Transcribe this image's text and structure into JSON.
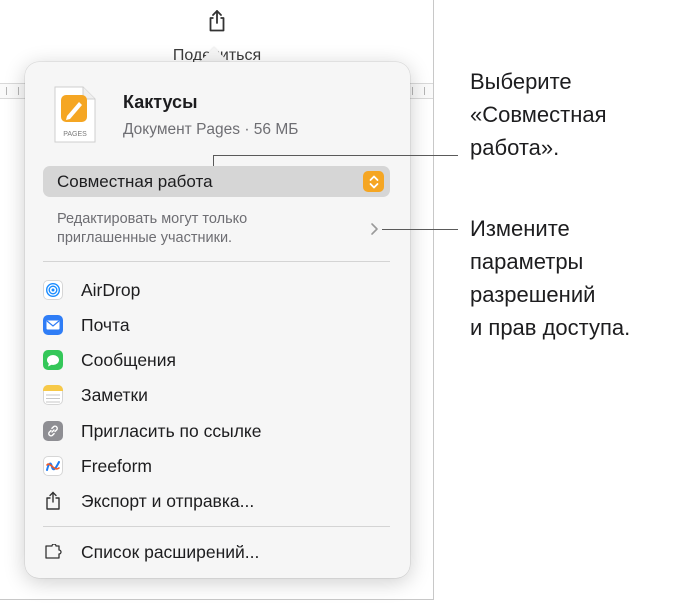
{
  "toolbar": {
    "share_label": "Поделиться"
  },
  "document": {
    "title": "Кактусы",
    "meta": "Документ Pages · 56 МБ",
    "icon_badge": "PAGES"
  },
  "collaboration": {
    "mode": "Совместная работа",
    "permissions_line1": "Редактировать могут только",
    "permissions_line2": "приглашенные участники."
  },
  "share_options": [
    {
      "label": "AirDrop",
      "icon": "airdrop-icon"
    },
    {
      "label": "Почта",
      "icon": "mail-icon"
    },
    {
      "label": "Сообщения",
      "icon": "messages-icon"
    },
    {
      "label": "Заметки",
      "icon": "notes-icon"
    },
    {
      "label": "Пригласить по ссылке",
      "icon": "link-icon"
    },
    {
      "label": "Freeform",
      "icon": "freeform-icon"
    },
    {
      "label": "Экспорт и отправка...",
      "icon": "export-icon"
    }
  ],
  "extensions": {
    "label": "Список расширений...",
    "icon": "extensions-icon"
  },
  "callouts": {
    "choose": [
      "Выберите",
      "«Совместная",
      "работа»."
    ],
    "change": [
      "Измените",
      "параметры",
      "разрешений",
      "и прав доступа."
    ]
  },
  "colors": {
    "accent_orange": "#f5a623",
    "mail_blue": "#2f7df6",
    "messages_green": "#34c759",
    "airdrop_blue": "#1a8cff"
  }
}
